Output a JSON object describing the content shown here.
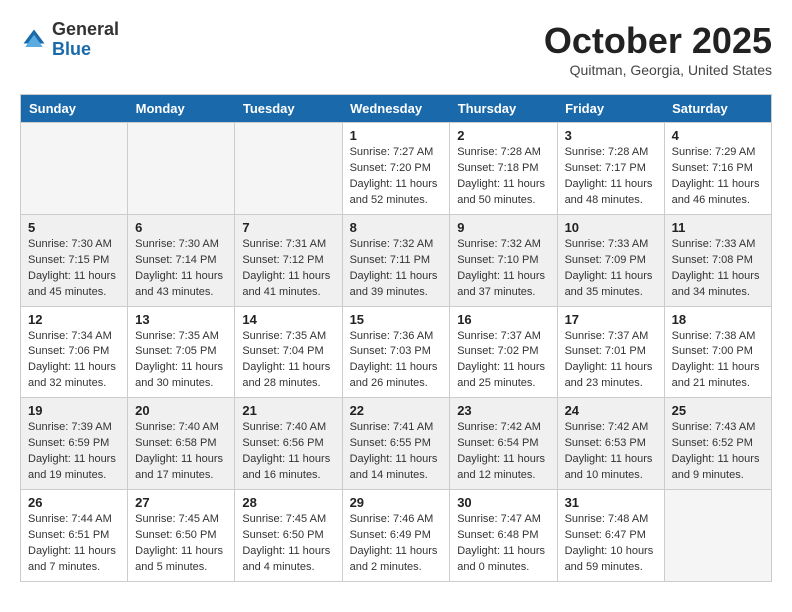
{
  "logo": {
    "general": "General",
    "blue": "Blue"
  },
  "title": "October 2025",
  "location": "Quitman, Georgia, United States",
  "days_of_week": [
    "Sunday",
    "Monday",
    "Tuesday",
    "Wednesday",
    "Thursday",
    "Friday",
    "Saturday"
  ],
  "weeks": [
    [
      {
        "day": "",
        "info": ""
      },
      {
        "day": "",
        "info": ""
      },
      {
        "day": "",
        "info": ""
      },
      {
        "day": "1",
        "info": "Sunrise: 7:27 AM\nSunset: 7:20 PM\nDaylight: 11 hours\nand 52 minutes."
      },
      {
        "day": "2",
        "info": "Sunrise: 7:28 AM\nSunset: 7:18 PM\nDaylight: 11 hours\nand 50 minutes."
      },
      {
        "day": "3",
        "info": "Sunrise: 7:28 AM\nSunset: 7:17 PM\nDaylight: 11 hours\nand 48 minutes."
      },
      {
        "day": "4",
        "info": "Sunrise: 7:29 AM\nSunset: 7:16 PM\nDaylight: 11 hours\nand 46 minutes."
      }
    ],
    [
      {
        "day": "5",
        "info": "Sunrise: 7:30 AM\nSunset: 7:15 PM\nDaylight: 11 hours\nand 45 minutes."
      },
      {
        "day": "6",
        "info": "Sunrise: 7:30 AM\nSunset: 7:14 PM\nDaylight: 11 hours\nand 43 minutes."
      },
      {
        "day": "7",
        "info": "Sunrise: 7:31 AM\nSunset: 7:12 PM\nDaylight: 11 hours\nand 41 minutes."
      },
      {
        "day": "8",
        "info": "Sunrise: 7:32 AM\nSunset: 7:11 PM\nDaylight: 11 hours\nand 39 minutes."
      },
      {
        "day": "9",
        "info": "Sunrise: 7:32 AM\nSunset: 7:10 PM\nDaylight: 11 hours\nand 37 minutes."
      },
      {
        "day": "10",
        "info": "Sunrise: 7:33 AM\nSunset: 7:09 PM\nDaylight: 11 hours\nand 35 minutes."
      },
      {
        "day": "11",
        "info": "Sunrise: 7:33 AM\nSunset: 7:08 PM\nDaylight: 11 hours\nand 34 minutes."
      }
    ],
    [
      {
        "day": "12",
        "info": "Sunrise: 7:34 AM\nSunset: 7:06 PM\nDaylight: 11 hours\nand 32 minutes."
      },
      {
        "day": "13",
        "info": "Sunrise: 7:35 AM\nSunset: 7:05 PM\nDaylight: 11 hours\nand 30 minutes."
      },
      {
        "day": "14",
        "info": "Sunrise: 7:35 AM\nSunset: 7:04 PM\nDaylight: 11 hours\nand 28 minutes."
      },
      {
        "day": "15",
        "info": "Sunrise: 7:36 AM\nSunset: 7:03 PM\nDaylight: 11 hours\nand 26 minutes."
      },
      {
        "day": "16",
        "info": "Sunrise: 7:37 AM\nSunset: 7:02 PM\nDaylight: 11 hours\nand 25 minutes."
      },
      {
        "day": "17",
        "info": "Sunrise: 7:37 AM\nSunset: 7:01 PM\nDaylight: 11 hours\nand 23 minutes."
      },
      {
        "day": "18",
        "info": "Sunrise: 7:38 AM\nSunset: 7:00 PM\nDaylight: 11 hours\nand 21 minutes."
      }
    ],
    [
      {
        "day": "19",
        "info": "Sunrise: 7:39 AM\nSunset: 6:59 PM\nDaylight: 11 hours\nand 19 minutes."
      },
      {
        "day": "20",
        "info": "Sunrise: 7:40 AM\nSunset: 6:58 PM\nDaylight: 11 hours\nand 17 minutes."
      },
      {
        "day": "21",
        "info": "Sunrise: 7:40 AM\nSunset: 6:56 PM\nDaylight: 11 hours\nand 16 minutes."
      },
      {
        "day": "22",
        "info": "Sunrise: 7:41 AM\nSunset: 6:55 PM\nDaylight: 11 hours\nand 14 minutes."
      },
      {
        "day": "23",
        "info": "Sunrise: 7:42 AM\nSunset: 6:54 PM\nDaylight: 11 hours\nand 12 minutes."
      },
      {
        "day": "24",
        "info": "Sunrise: 7:42 AM\nSunset: 6:53 PM\nDaylight: 11 hours\nand 10 minutes."
      },
      {
        "day": "25",
        "info": "Sunrise: 7:43 AM\nSunset: 6:52 PM\nDaylight: 11 hours\nand 9 minutes."
      }
    ],
    [
      {
        "day": "26",
        "info": "Sunrise: 7:44 AM\nSunset: 6:51 PM\nDaylight: 11 hours\nand 7 minutes."
      },
      {
        "day": "27",
        "info": "Sunrise: 7:45 AM\nSunset: 6:50 PM\nDaylight: 11 hours\nand 5 minutes."
      },
      {
        "day": "28",
        "info": "Sunrise: 7:45 AM\nSunset: 6:50 PM\nDaylight: 11 hours\nand 4 minutes."
      },
      {
        "day": "29",
        "info": "Sunrise: 7:46 AM\nSunset: 6:49 PM\nDaylight: 11 hours\nand 2 minutes."
      },
      {
        "day": "30",
        "info": "Sunrise: 7:47 AM\nSunset: 6:48 PM\nDaylight: 11 hours\nand 0 minutes."
      },
      {
        "day": "31",
        "info": "Sunrise: 7:48 AM\nSunset: 6:47 PM\nDaylight: 10 hours\nand 59 minutes."
      },
      {
        "day": "",
        "info": ""
      }
    ]
  ]
}
